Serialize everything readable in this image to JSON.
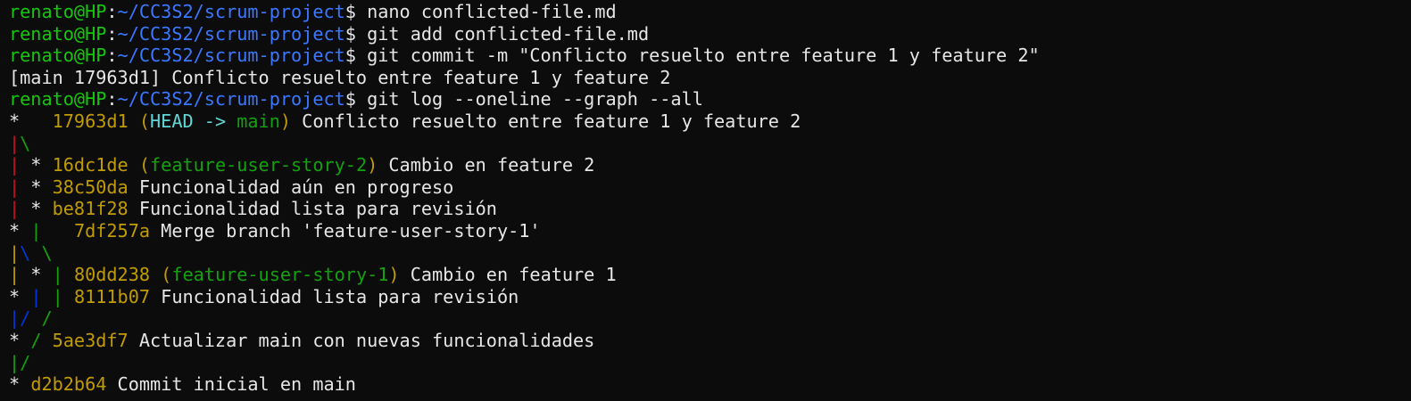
{
  "terminal": {
    "colors": {
      "background": "#0c0c0c",
      "foreground": "#e6e6e6",
      "prompt_user": "#16c60c",
      "prompt_path": "#3b78ff",
      "hash": "#c19c00",
      "head": "#61d6d6",
      "branch": "#13a10e",
      "graph_red": "#c50f1f",
      "graph_yellow": "#c19c00",
      "graph_green": "#13a10e",
      "graph_blue": "#0037da"
    },
    "lines": [
      {
        "type": "prompt",
        "user": "renato@HP",
        "sep": ":",
        "path": "~/CC3S2/scrum-project",
        "sym": "$ ",
        "cmd": "nano conflicted-file.md"
      },
      {
        "type": "prompt",
        "user": "renato@HP",
        "sep": ":",
        "path": "~/CC3S2/scrum-project",
        "sym": "$ ",
        "cmd": "git add conflicted-file.md"
      },
      {
        "type": "prompt",
        "user": "renato@HP",
        "sep": ":",
        "path": "~/CC3S2/scrum-project",
        "sym": "$ ",
        "cmd": "git commit -m \"Conflicto resuelto entre feature 1 y feature 2\""
      },
      {
        "type": "output",
        "segments": [
          {
            "t": "[main 17963d1] Conflicto resuelto entre feature 1 y feature 2",
            "c": "white"
          }
        ]
      },
      {
        "type": "prompt",
        "user": "renato@HP",
        "sep": ":",
        "path": "~/CC3S2/scrum-project",
        "sym": "$ ",
        "cmd": "git log --oneline --graph --all"
      },
      {
        "type": "output",
        "segments": [
          {
            "t": "*   ",
            "c": "white"
          },
          {
            "t": "17963d1",
            "c": "hash"
          },
          {
            "t": " ",
            "c": "white"
          },
          {
            "t": "(",
            "c": "hash"
          },
          {
            "t": "HEAD -> ",
            "c": "head"
          },
          {
            "t": "main",
            "c": "main"
          },
          {
            "t": ")",
            "c": "hash"
          },
          {
            "t": " Conflicto resuelto entre feature 1 y feature 2",
            "c": "white"
          }
        ]
      },
      {
        "type": "output",
        "segments": [
          {
            "t": "|",
            "c": "red"
          },
          {
            "t": "\\",
            "c": "green"
          }
        ]
      },
      {
        "type": "output",
        "segments": [
          {
            "t": "|",
            "c": "red"
          },
          {
            "t": " * ",
            "c": "white"
          },
          {
            "t": "16dc1de",
            "c": "hash"
          },
          {
            "t": " ",
            "c": "white"
          },
          {
            "t": "(",
            "c": "hash"
          },
          {
            "t": "feature-user-story-2",
            "c": "branch"
          },
          {
            "t": ")",
            "c": "hash"
          },
          {
            "t": " Cambio en feature 2",
            "c": "white"
          }
        ]
      },
      {
        "type": "output",
        "segments": [
          {
            "t": "|",
            "c": "red"
          },
          {
            "t": " * ",
            "c": "white"
          },
          {
            "t": "38c50da",
            "c": "hash"
          },
          {
            "t": " Funcionalidad aún en progreso",
            "c": "white"
          }
        ]
      },
      {
        "type": "output",
        "segments": [
          {
            "t": "|",
            "c": "red"
          },
          {
            "t": " * ",
            "c": "white"
          },
          {
            "t": "be81f28",
            "c": "hash"
          },
          {
            "t": " Funcionalidad lista para revisión",
            "c": "white"
          }
        ]
      },
      {
        "type": "output",
        "segments": [
          {
            "t": "* ",
            "c": "white"
          },
          {
            "t": "|",
            "c": "green"
          },
          {
            "t": "   ",
            "c": "white"
          },
          {
            "t": "7df257a",
            "c": "hash"
          },
          {
            "t": " Merge branch 'feature-user-story-1'",
            "c": "white"
          }
        ]
      },
      {
        "type": "output",
        "segments": [
          {
            "t": "|",
            "c": "yellow"
          },
          {
            "t": "\\",
            "c": "blue"
          },
          {
            "t": " ",
            "c": "white"
          },
          {
            "t": "\\",
            "c": "green"
          }
        ]
      },
      {
        "type": "output",
        "segments": [
          {
            "t": "|",
            "c": "yellow"
          },
          {
            "t": " * ",
            "c": "white"
          },
          {
            "t": "|",
            "c": "green"
          },
          {
            "t": " ",
            "c": "white"
          },
          {
            "t": "80dd238",
            "c": "hash"
          },
          {
            "t": " ",
            "c": "white"
          },
          {
            "t": "(",
            "c": "hash"
          },
          {
            "t": "feature-user-story-1",
            "c": "branch"
          },
          {
            "t": ")",
            "c": "hash"
          },
          {
            "t": " Cambio en feature 1",
            "c": "white"
          }
        ]
      },
      {
        "type": "output",
        "segments": [
          {
            "t": "* ",
            "c": "white"
          },
          {
            "t": "|",
            "c": "blue"
          },
          {
            "t": " ",
            "c": "white"
          },
          {
            "t": "|",
            "c": "green"
          },
          {
            "t": " ",
            "c": "white"
          },
          {
            "t": "8111b07",
            "c": "hash"
          },
          {
            "t": " Funcionalidad lista para revisión",
            "c": "white"
          }
        ]
      },
      {
        "type": "output",
        "segments": [
          {
            "t": "|",
            "c": "blue"
          },
          {
            "t": "/",
            "c": "blue"
          },
          {
            "t": " ",
            "c": "white"
          },
          {
            "t": "/",
            "c": "green"
          }
        ]
      },
      {
        "type": "output",
        "segments": [
          {
            "t": "* ",
            "c": "white"
          },
          {
            "t": "/",
            "c": "green"
          },
          {
            "t": " ",
            "c": "white"
          },
          {
            "t": "5ae3df7",
            "c": "hash"
          },
          {
            "t": " Actualizar main con nuevas funcionalidades",
            "c": "white"
          }
        ]
      },
      {
        "type": "output",
        "segments": [
          {
            "t": "|",
            "c": "green"
          },
          {
            "t": "/",
            "c": "green"
          }
        ]
      },
      {
        "type": "output",
        "segments": [
          {
            "t": "* ",
            "c": "white"
          },
          {
            "t": "d2b2b64",
            "c": "hash"
          },
          {
            "t": " Commit inicial en main",
            "c": "white"
          }
        ]
      }
    ]
  }
}
